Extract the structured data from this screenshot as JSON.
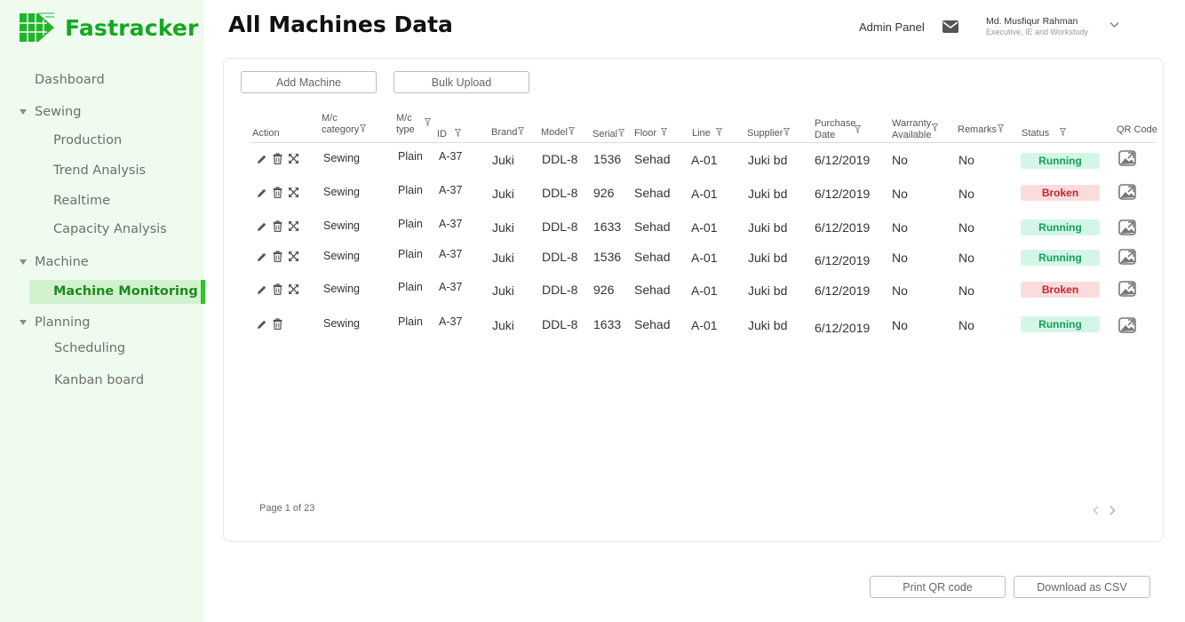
{
  "brand": {
    "name": "Fastracker",
    "color": "#14a821"
  },
  "sidebar": {
    "dashboard": "Dashboard",
    "groups": [
      {
        "label": "Sewing",
        "items": [
          "Production",
          "Trend Analysis",
          "Realtime",
          "Capacity Analysis"
        ]
      },
      {
        "label": "Machine",
        "items": [
          "Machine Monitoring"
        ]
      },
      {
        "label": "Planning",
        "items": [
          "Scheduling",
          "Kanban board"
        ]
      }
    ],
    "active_item": "Machine Monitoring"
  },
  "header": {
    "title": "All Machines Data",
    "admin_panel": "Admin Panel",
    "user": {
      "name": "Md. Musfiqur Rahman",
      "role": "Executive, IE and Workstudy"
    }
  },
  "toolbar": {
    "add_machine": "Add Machine",
    "bulk_upload": "Bulk Upload"
  },
  "table": {
    "columns": {
      "action": "Action",
      "category": [
        "M/c",
        "category"
      ],
      "type": [
        "M/c",
        "type"
      ],
      "id": "ID",
      "brand": "Brand",
      "model": "Model",
      "serial": "Serial",
      "floor": "Floor",
      "line": "Line",
      "supplier": "Supplier",
      "purchase_date": [
        "Purchase",
        "Date"
      ],
      "warranty": [
        "Warranty",
        "Available"
      ],
      "remarks": "Remarks",
      "status": "Status",
      "qr_code": "QR Code"
    },
    "rows": [
      {
        "category": "Sewing",
        "type": "Plain",
        "id": "A-37",
        "brand": "Juki",
        "model": "DDL-8",
        "serial": "1536",
        "floor": "Sehad",
        "line": "A-01",
        "supplier": "Juki bd",
        "purchase_date": "6/12/2019",
        "warranty": "No",
        "remarks": "No",
        "status": "Running",
        "status_key": "running",
        "expand": true
      },
      {
        "category": "Sewing",
        "type": "Plain",
        "id": "A-37",
        "brand": "Juki",
        "model": "DDL-8",
        "serial": "926",
        "floor": "Sehad",
        "line": "A-01",
        "supplier": "Juki bd",
        "purchase_date": "6/12/2019",
        "warranty": "No",
        "remarks": "No",
        "status": "Broken",
        "status_key": "broken",
        "expand": true
      },
      {
        "category": "Sewing",
        "type": "Plain",
        "id": "A-37",
        "brand": "Juki",
        "model": "DDL-8",
        "serial": "1633",
        "floor": "Sehad",
        "line": "A-01",
        "supplier": "Juki bd",
        "purchase_date": "6/12/2019",
        "warranty": "No",
        "remarks": "No",
        "status": "Running",
        "status_key": "running",
        "expand": true
      },
      {
        "category": "Sewing",
        "type": "Plain",
        "id": "A-37",
        "brand": "Juki",
        "model": "DDL-8",
        "serial": "1536",
        "floor": "Sehad",
        "line": "A-01",
        "supplier": "Juki bd",
        "purchase_date": "6/12/2019",
        "warranty": "No",
        "remarks": "No",
        "status": "Running",
        "status_key": "running",
        "expand": true
      },
      {
        "category": "Sewing",
        "type": "Plain",
        "id": "A-37",
        "brand": "Juki",
        "model": "DDL-8",
        "serial": "926",
        "floor": "Sehad",
        "line": "A-01",
        "supplier": "Juki bd",
        "purchase_date": "6/12/2019",
        "warranty": "No",
        "remarks": "No",
        "status": "Broken",
        "status_key": "broken",
        "expand": true
      },
      {
        "category": "Sewing",
        "type": "Plain",
        "id": "A-37",
        "brand": "Juki",
        "model": "DDL-8",
        "serial": "1633",
        "floor": "Sehad",
        "line": "A-01",
        "supplier": "Juki bd",
        "purchase_date": "6/12/2019",
        "warranty": "No",
        "remarks": "No",
        "status": "Running",
        "status_key": "running",
        "expand": false
      }
    ]
  },
  "pagination": {
    "label": "Page 1 of 23"
  },
  "footer": {
    "print_qr": "Print QR code",
    "download_csv": "Download as CSV"
  },
  "icons": {
    "logo": "logo-icon",
    "mail": "mail-icon",
    "user_menu": "chevron-down-icon",
    "filter": "filter-icon",
    "edit": "pencil-icon",
    "delete": "trash-icon",
    "expand": "expand-icon",
    "qr": "qr-code-icon",
    "prev": "chevron-left-icon",
    "next": "chevron-right-icon"
  },
  "colors": {
    "sidebar_bg": "#effbee",
    "active_bg": "#d2f2cf",
    "active_bar": "#2dc52a",
    "running_bg": "#d3f6e6",
    "running_text": "#15a05a",
    "broken_bg": "#fbdcdc",
    "broken_text": "#c0262a"
  }
}
